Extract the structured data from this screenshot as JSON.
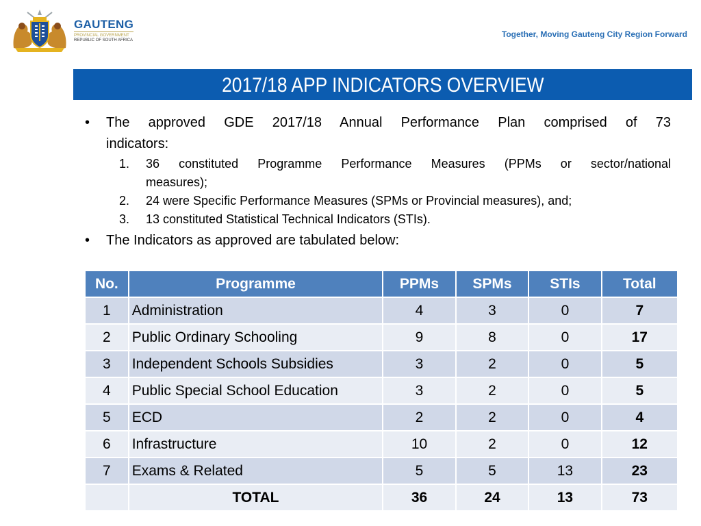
{
  "header": {
    "org_name": "GAUTENG",
    "org_sub1": "PROVINCIAL GOVERNMENT",
    "org_sub2": "REPUBLIC OF SOUTH AFRICA",
    "slogan": "Together, Moving Gauteng City Region Forward",
    "crest_icon": "coat-of-arms-icon"
  },
  "title": "2017/18 APP INDICATORS OVERVIEW",
  "colors": {
    "title_bar": "#0c5cb0",
    "table_header": "#4f81bd",
    "row_dark": "#d0d8e8",
    "row_light": "#e9edf4",
    "brand_blue": "#1d5fa6"
  },
  "bullets": {
    "b1_line1": "The approved GDE 2017/18 Annual Performance Plan comprised of 73",
    "b1_line2": "indicators:",
    "sub": [
      {
        "num": "1.",
        "line1": "36 constituted Programme Performance Measures (PPMs or sector/national",
        "line2": "measures);"
      },
      {
        "num": "2.",
        "line1": "24 were Specific Performance Measures (SPMs or Provincial measures), and;"
      },
      {
        "num": "3.",
        "line1": "13 constituted Statistical Technical Indicators (STIs)."
      }
    ],
    "b2": "The Indicators as approved are tabulated below:"
  },
  "table": {
    "headers": [
      "No.",
      "Programme",
      "PPMs",
      "SPMs",
      "STIs",
      "Total"
    ],
    "rows": [
      {
        "no": "1",
        "programme": " Administration",
        "ppms": "4",
        "spms": "3",
        "stis": "0",
        "total": "7"
      },
      {
        "no": "2",
        "programme": "Public Ordinary Schooling",
        "ppms": "9",
        "spms": "8",
        "stis": "0",
        "total": "17"
      },
      {
        "no": "3",
        "programme": "Independent  Schools Subsidies",
        "ppms": "3",
        "spms": "2",
        "stis": "0",
        "total": "5"
      },
      {
        "no": "4",
        "programme": "Public Special School Education",
        "ppms": "3",
        "spms": "2",
        "stis": "0",
        "total": "5"
      },
      {
        "no": "5",
        "programme": "ECD",
        "ppms": "2",
        "spms": "2",
        "stis": "0",
        "total": "4"
      },
      {
        "no": "6",
        "programme": "Infrastructure",
        "ppms": "10",
        "spms": "2",
        "stis": "0",
        "total": "12"
      },
      {
        "no": "7",
        "programme": "Exams & Related",
        "ppms": "5",
        "spms": "5",
        "stis": "13",
        "total": "23"
      }
    ],
    "total_row": {
      "no": "",
      "label": "TOTAL",
      "ppms": "36",
      "spms": "24",
      "stis": "13",
      "total": "73"
    }
  }
}
